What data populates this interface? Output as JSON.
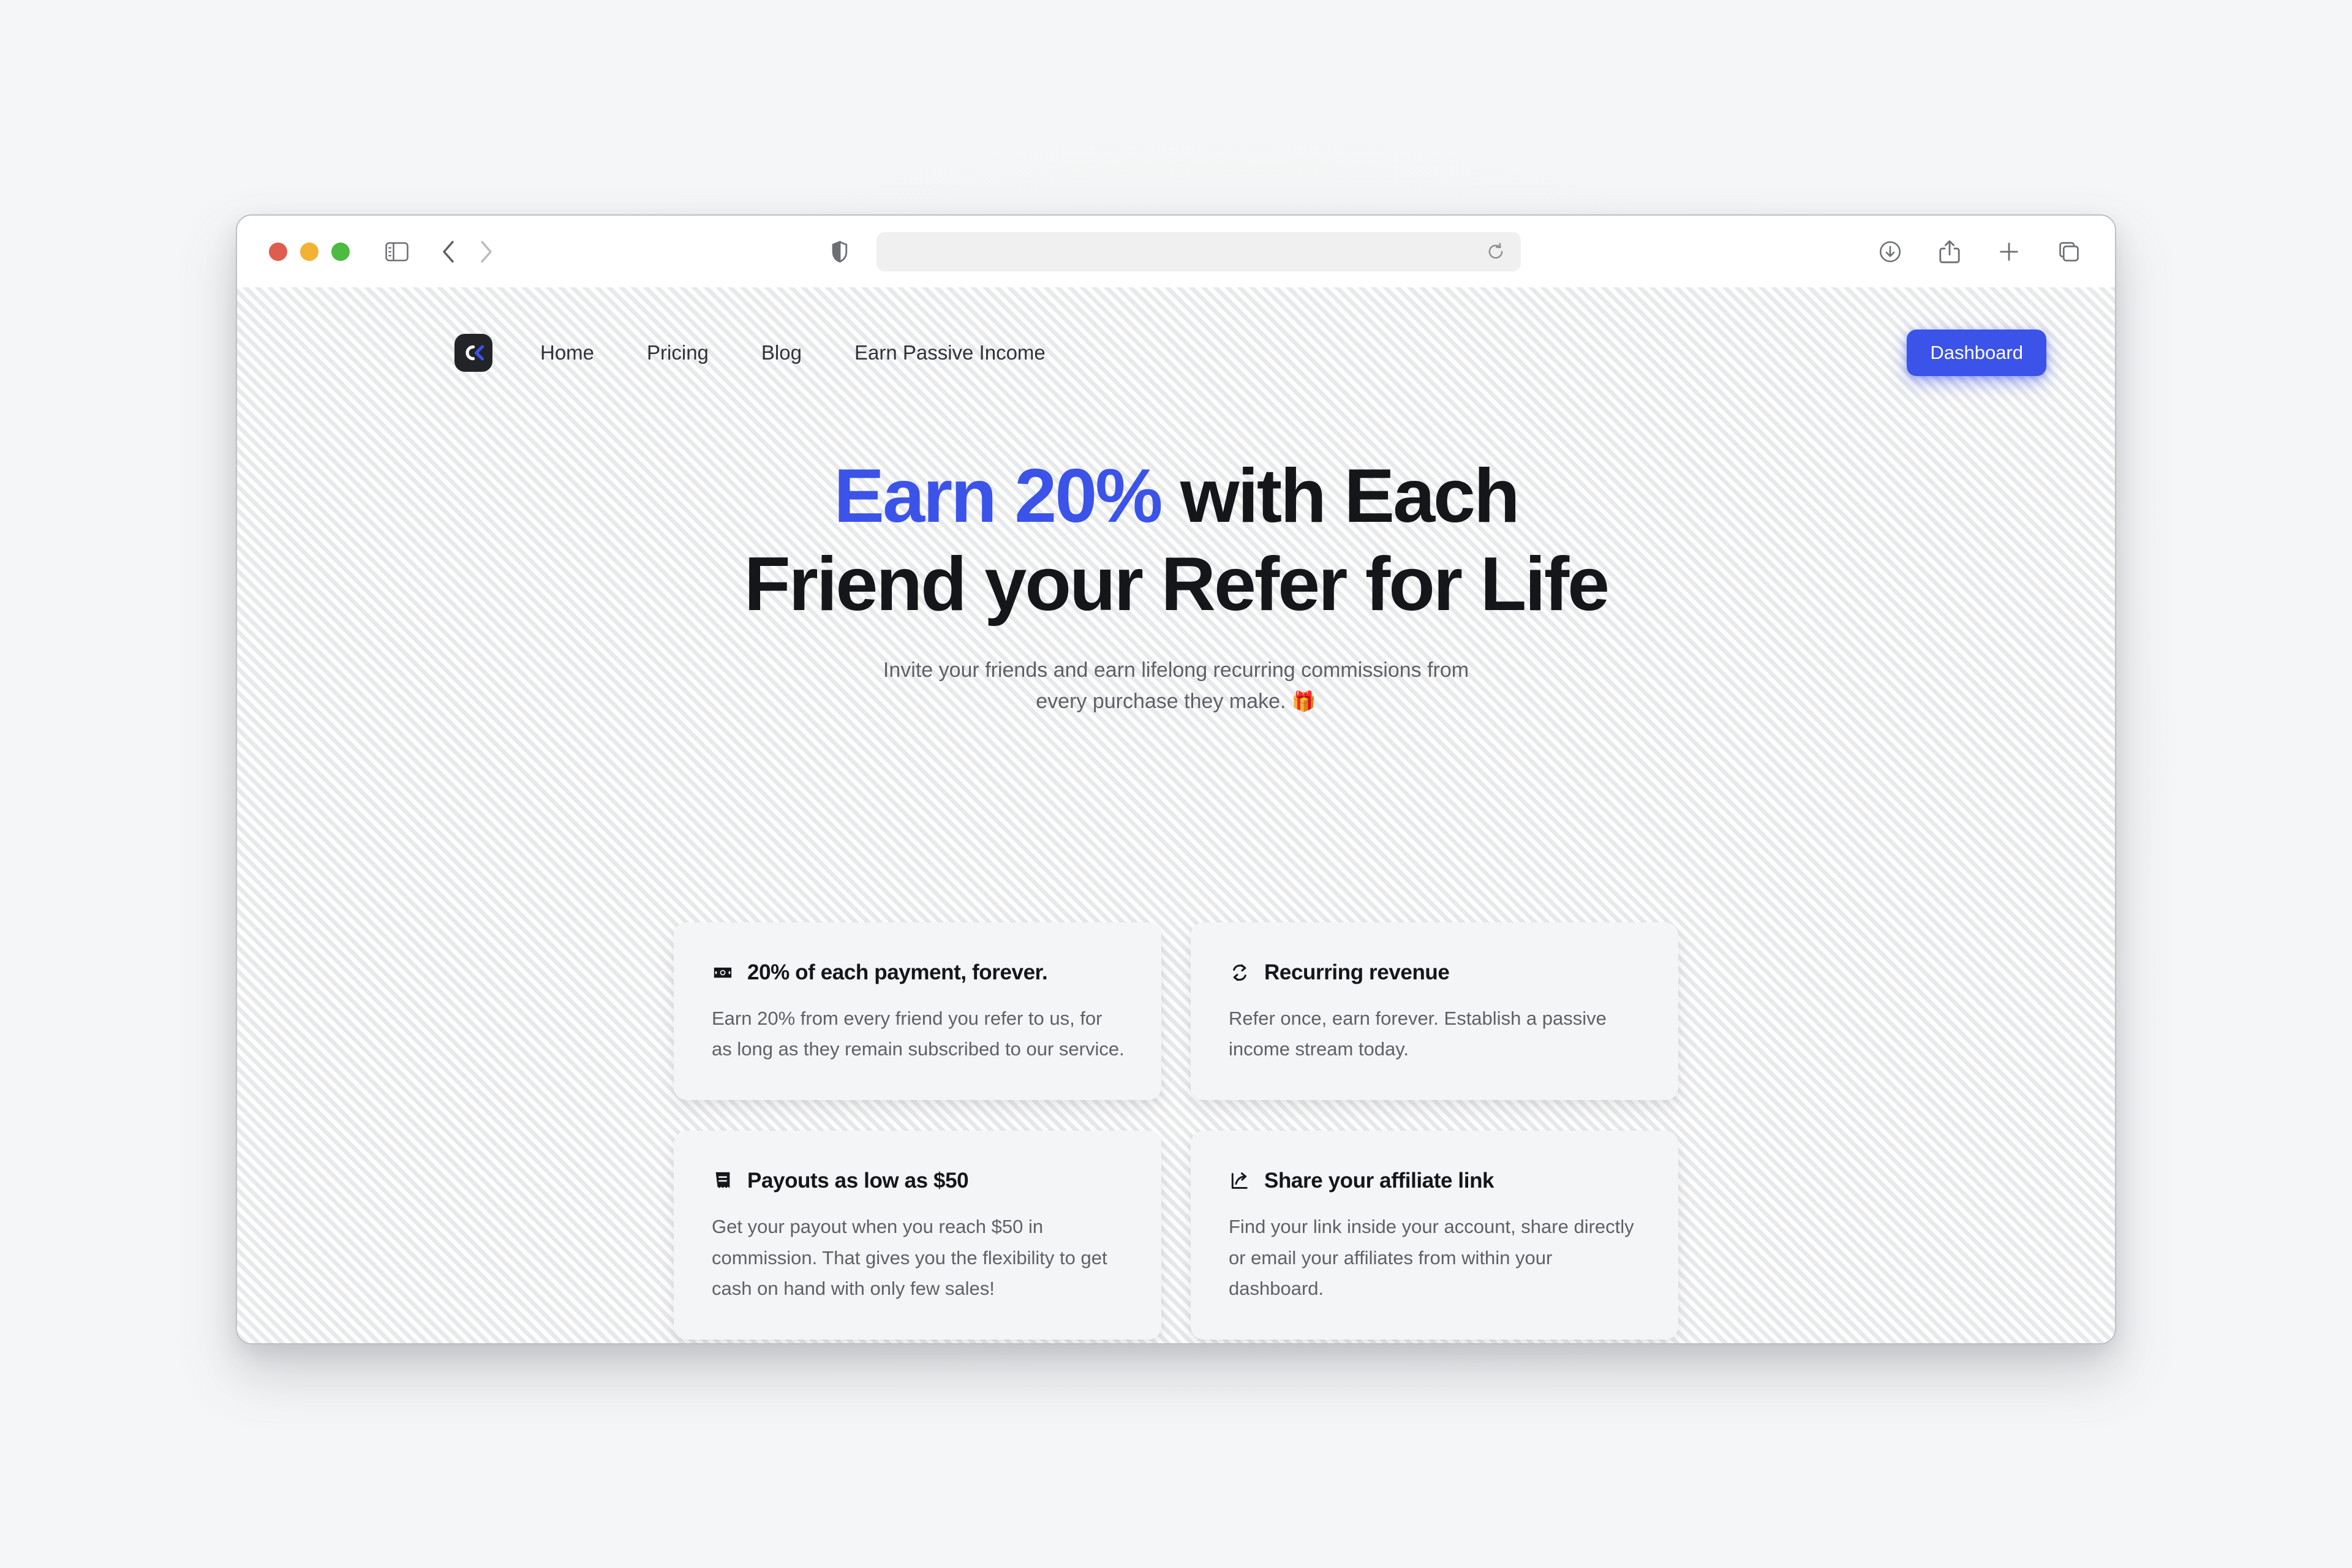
{
  "browser": {
    "traffic_lights": [
      "close",
      "minimize",
      "maximize"
    ],
    "sidebar_toggle": "sidebar-toggle",
    "back": "back",
    "forward": "forward",
    "privacy_icon": "shield-icon",
    "address_value": "",
    "address_placeholder": "",
    "reload": "reload",
    "right_icons": [
      "downloads-icon",
      "share-icon",
      "new-tab-icon",
      "tab-overview-icon"
    ]
  },
  "site": {
    "logo_letter": "C",
    "nav_links": [
      {
        "label": "Home"
      },
      {
        "label": "Pricing"
      },
      {
        "label": "Blog"
      },
      {
        "label": "Earn Passive Income"
      }
    ],
    "cta_label": "Dashboard",
    "accent_color": "#3B53E8"
  },
  "hero": {
    "heading_line1_accent": "Earn 20%",
    "heading_line1_rest": " with Each",
    "heading_line2": "Friend your Refer for Life",
    "subtitle_line1": "Invite your friends and earn lifelong recurring commissions from",
    "subtitle_line2": "every purchase they make. ",
    "subtitle_emoji": "🎁"
  },
  "features": [
    {
      "icon": "banknote-icon",
      "title": "20% of each payment, forever.",
      "description": "Earn 20% from every friend you refer to us, for as long as they remain subscribed to our service."
    },
    {
      "icon": "refresh-cycle-icon",
      "title": "Recurring revenue",
      "description": "Refer once, earn forever. Establish a passive income stream today."
    },
    {
      "icon": "receipt-icon",
      "title": "Payouts as low as $50",
      "description": "Get your payout when you reach $50 in commission. That gives you the flexibility to get cash on hand with only few sales!"
    },
    {
      "icon": "share-arrow-icon",
      "title": "Share your affiliate link",
      "description": "Find your link inside your account, share directly or email your affiliates from within your dashboard."
    }
  ]
}
